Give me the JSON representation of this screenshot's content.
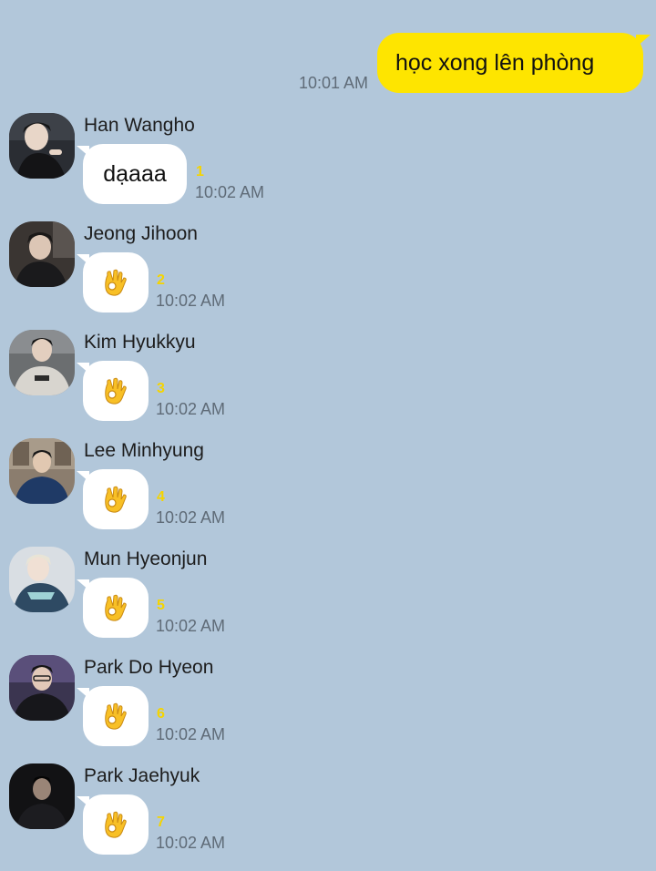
{
  "outgoing": {
    "text": "học xong lên phòng",
    "time": "10:01 AM"
  },
  "messages": [
    {
      "sender": "Han Wangho",
      "text": "dạaaa",
      "unread": "1",
      "time": "10:02 AM",
      "avatar_icon": "profile-photo",
      "avatar_bg": "#2a2d33"
    },
    {
      "sender": "Jeong Jihoon",
      "emoji": "ok-hand",
      "unread": "2",
      "time": "10:02 AM",
      "avatar_icon": "profile-photo",
      "avatar_bg": "#3a3532"
    },
    {
      "sender": "Kim Hyukkyu",
      "emoji": "ok-hand",
      "unread": "3",
      "time": "10:02 AM",
      "avatar_icon": "profile-photo",
      "avatar_bg": "#6b6e70"
    },
    {
      "sender": "Lee Minhyung",
      "emoji": "ok-hand",
      "unread": "4",
      "time": "10:02 AM",
      "avatar_icon": "profile-photo",
      "avatar_bg": "#8b7d6e"
    },
    {
      "sender": "Mun Hyeonjun",
      "emoji": "ok-hand",
      "unread": "5",
      "time": "10:02 AM",
      "avatar_icon": "profile-photo",
      "avatar_bg": "#d9dee3"
    },
    {
      "sender": "Park Do Hyeon",
      "emoji": "ok-hand",
      "unread": "6",
      "time": "10:02 AM",
      "avatar_icon": "profile-photo",
      "avatar_bg": "#3b3550"
    },
    {
      "sender": "Park Jaehyuk",
      "emoji": "ok-hand",
      "unread": "7",
      "time": "10:02 AM",
      "avatar_icon": "profile-photo",
      "avatar_bg": "#121214"
    }
  ],
  "colors": {
    "background": "#b2c7da",
    "outgoing_bubble": "#fee500",
    "incoming_bubble": "#ffffff",
    "unread": "#f5d400",
    "timestamp": "#5f6b77"
  }
}
